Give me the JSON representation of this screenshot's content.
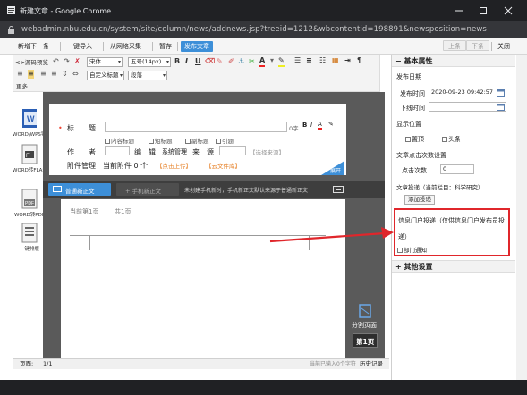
{
  "browser": {
    "title": "新建文章 - Google Chrome",
    "url": "webadmin.nbu.edu.cn/system/site/column/news/addnews.jsp?treeid=1212&wbcontentid=198891&newsposition=news"
  },
  "toolbar": {
    "new_next": "新增下一条",
    "import": "一键导入",
    "collect": "从网络采集",
    "save_draft": "暂存",
    "publish": "发布文章",
    "prev": "上条",
    "next": "下条",
    "close": "关闭"
  },
  "editor_toolbar": {
    "source": "源码",
    "preview": "预览",
    "font": "宋体",
    "size": "五号(14px)",
    "bold": "B",
    "italic": "I",
    "underline": "U",
    "custom_heading": "自定义标题",
    "paragraph": "段落",
    "more": "更多"
  },
  "left_tools": [
    {
      "label": "WORD/WPS导入",
      "icon": "word-icon"
    },
    {
      "label": "WORD转FLASH",
      "icon": "flash-icon"
    },
    {
      "label": "WORD转PDF",
      "icon": "pdf-icon"
    },
    {
      "label": "一键排版",
      "icon": "format-icon"
    }
  ],
  "form": {
    "title_label": "标　　题",
    "title_counter": "0字",
    "options": [
      "内容标题",
      "短标题",
      "副标题",
      "引题"
    ],
    "author_label": "作　　者",
    "editor_label": "编　辑",
    "editor_value": "系统管理",
    "source_label": "来　源",
    "select_source": "【选择来源】",
    "attach_label": "附件管理",
    "attach_count": "当前附件 0 个",
    "upload": "【点击上传】",
    "upload_all": "【云文件库】",
    "expand_btn": "展开"
  },
  "mode_bar": {
    "normal": "普通新正文",
    "mobile": "+ 手机新正文",
    "hint": "未创建手机新时，手机新正文默认来源于普通新正文"
  },
  "page2": {
    "page_label": "当前第1页",
    "total": "共1页",
    "split_label": "分割页面",
    "page_btn": "第1页"
  },
  "status": {
    "page": "页面:",
    "page_val": "1/1",
    "chars": "当前已输入0个字符",
    "history": "历史记录"
  },
  "right_panel": {
    "basic_title": "基本属性",
    "publish_date": "发布日期",
    "publish_time_label": "发布时间",
    "publish_time_value": "2020-09-23 09:42:57",
    "offline_label": "下线时间",
    "display_pos": "显示位置",
    "top_label": "置顶",
    "headline_label": "头条",
    "click_settings": "文章点击次数设置",
    "click_count_label": "点击次数",
    "click_count_value": "0",
    "delivery": "文章投递（当前栏目：科学研究）",
    "add_delivery": "添加投递",
    "info_portal": "信息门户投递（仅供信息门户发布员投递）",
    "dept_notice": "部门通知",
    "other_settings": "其他设置"
  },
  "colors": {
    "accent": "#3d8fd8",
    "highlight_box": "#e0262b",
    "chrome_dark": "#202124"
  }
}
